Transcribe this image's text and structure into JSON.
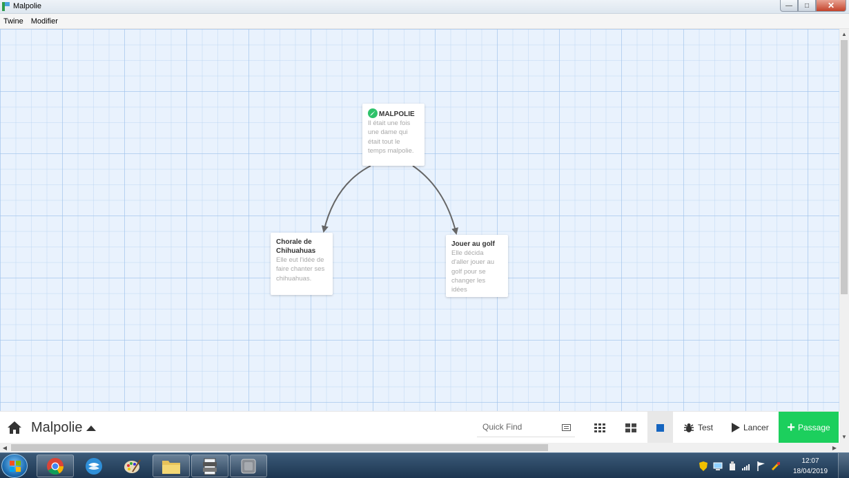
{
  "window": {
    "title": "Malpolie",
    "controls": {
      "minimize": "—",
      "maximize": "□",
      "close": "✕"
    }
  },
  "menu": [
    {
      "label": "Twine"
    },
    {
      "label": "Modifier"
    }
  ],
  "passages": {
    "start": {
      "title": "MALPOLIE",
      "excerpt": "Il était une fois une dame qui était tout le temps malpolie.",
      "is_start": true
    },
    "chorale": {
      "title": "Chorale de Chihuahuas",
      "excerpt": "Elle eut l'idée de faire chanter ses chihuahuas."
    },
    "golf": {
      "title": "Jouer au golf",
      "excerpt": "Elle décida d'aller jouer au golf pour se changer les idées"
    }
  },
  "toolbar": {
    "story_title": "Malpolie",
    "quick_find_placeholder": "Quick Find",
    "test_label": "Test",
    "play_label": "Lancer",
    "passage_label": "Passage"
  },
  "colors": {
    "map_background": "#e9f2fd",
    "passage_button": "#1ccf5d",
    "start_icon": "#2ec26a",
    "zoom_active": "#1565c0"
  },
  "taskbar": {
    "apps": [
      "chrome-icon",
      "thunderbird-icon",
      "paint-icon",
      "explorer-icon",
      "archive-icon",
      "twine-app-icon"
    ],
    "clock_time": "12:07",
    "clock_date": "18/04/2019"
  }
}
